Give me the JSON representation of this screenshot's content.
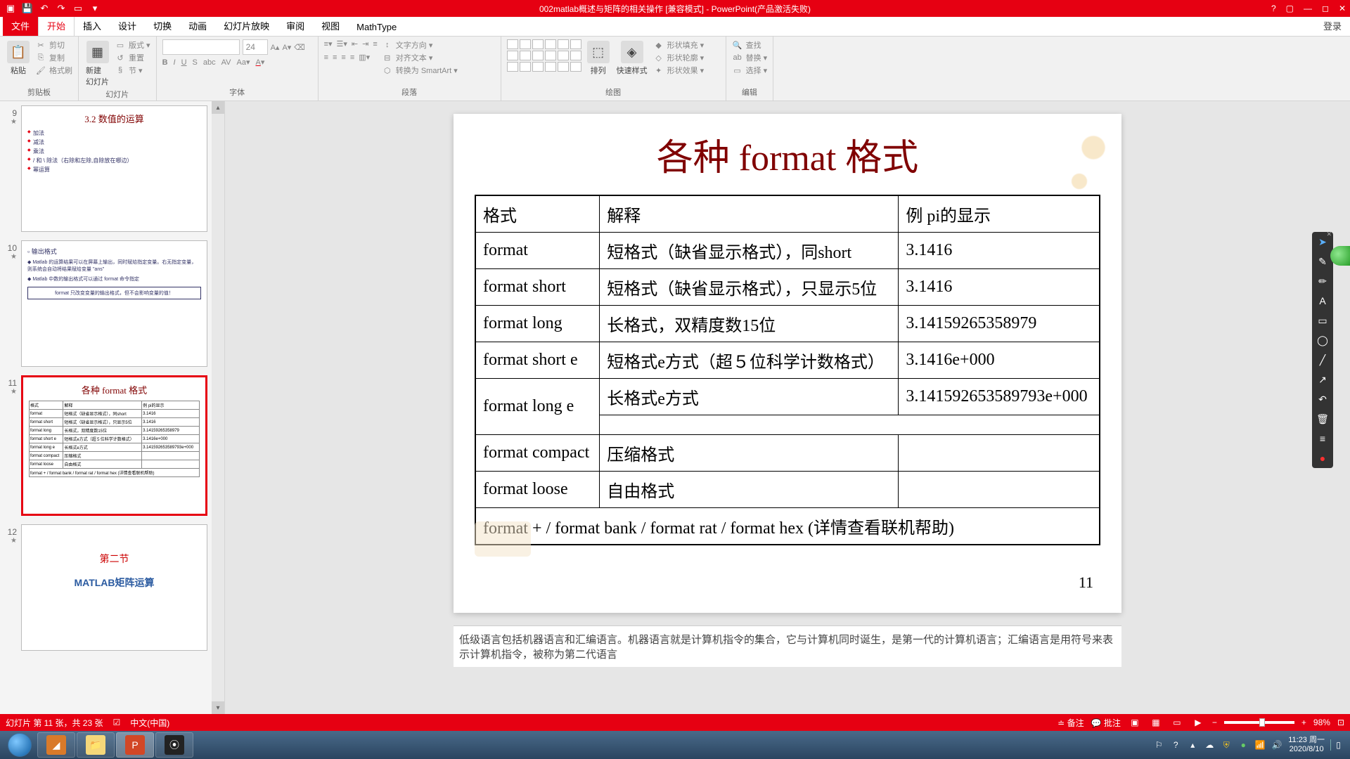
{
  "titlebar": {
    "doc_title": "002matlab概述与矩阵的相关操作 [兼容模式] - PowerPoint(产品激活失败)"
  },
  "ribbon": {
    "tabs": [
      "文件",
      "开始",
      "插入",
      "设计",
      "切换",
      "动画",
      "幻灯片放映",
      "审阅",
      "视图",
      "MathType"
    ],
    "login": "登录",
    "groups": {
      "clipboard": {
        "label": "剪贴板",
        "paste": "粘贴",
        "cut": "剪切",
        "copy": "复制",
        "painter": "格式刷"
      },
      "slides": {
        "label": "幻灯片",
        "new": "新建\n幻灯片",
        "layout": "版式 ▾",
        "reset": "重置",
        "section": "节 ▾"
      },
      "font": {
        "label": "字体",
        "size": "24"
      },
      "paragraph": {
        "label": "段落",
        "textdir": "文字方向 ▾",
        "align": "对齐文本 ▾",
        "smartart": "转换为 SmartArt ▾"
      },
      "drawing": {
        "label": "绘图",
        "arrange": "排列",
        "quickstyle": "快速样式",
        "fill": "形状填充 ▾",
        "outline": "形状轮廓 ▾",
        "effects": "形状效果 ▾"
      },
      "editing": {
        "label": "编辑",
        "find": "查找",
        "replace": "替换 ▾",
        "select": "选择 ▾"
      }
    }
  },
  "thumbs": [
    {
      "num": "9",
      "title": "3.2 数值的运算",
      "items": [
        "加法",
        "减法",
        "乘法",
        "/ 和 \\ 除法（右除和左除,自除放在哪边）",
        "幂运算"
      ]
    },
    {
      "num": "10",
      "title": "输出格式",
      "bullets": [
        "Matlab 的运算结果可以在屏幕上输出，同时赋给指定变量。右无指定变量，则系统会自动将结果赋给变量 \"ans\"",
        "Matlab 中数的输出格式可以通过 format 命令指定"
      ],
      "box": "format 只改变变量的输出格式，但不会影响变量的值！"
    },
    {
      "num": "11",
      "title": "各种 format 格式"
    },
    {
      "num": "12",
      "title": "第二节",
      "sub": "MATLAB矩阵运算"
    }
  ],
  "slide": {
    "title": "各种 format 格式",
    "headers": [
      "格式",
      "解释",
      "例 pi的显示"
    ],
    "rows": [
      [
        "format",
        "短格式（缺省显示格式），同short",
        "3.1416"
      ],
      [
        "format short",
        "短格式（缺省显示格式），只显示5位",
        "3.1416"
      ],
      [
        "format long",
        "长格式，双精度数15位",
        "3.14159265358979"
      ],
      [
        "format short e",
        "短格式e方式（超５位科学计数格式）",
        "3.1416e+000"
      ],
      [
        "format long e",
        "长格式e方式",
        "3.14159265358979"
      ],
      [
        "format compact",
        "压缩格式",
        ""
      ],
      [
        "format loose",
        "自由格式",
        ""
      ]
    ],
    "row5_val": "3.14159265358979​3e+000",
    "footer": "format +  /  format bank  /  format rat / format hex   (详情查看联机帮助)",
    "pagenum": "11"
  },
  "notes": "低级语言包括机器语言和汇编语言。机器语言就是计算机指令的集合，它与计算机同时诞生，是第一代的计算机语言；汇编语言是用符号来表示计算机指令，被称为第二代语言",
  "statusbar": {
    "slide_pos": "幻灯片 第 11 张，共 23 张",
    "lang": "中文(中国)",
    "notes_btn": "备注",
    "comments_btn": "批注",
    "zoom": "98%"
  },
  "tray": {
    "time": "11:23 周一",
    "date": "2020/8/10"
  }
}
